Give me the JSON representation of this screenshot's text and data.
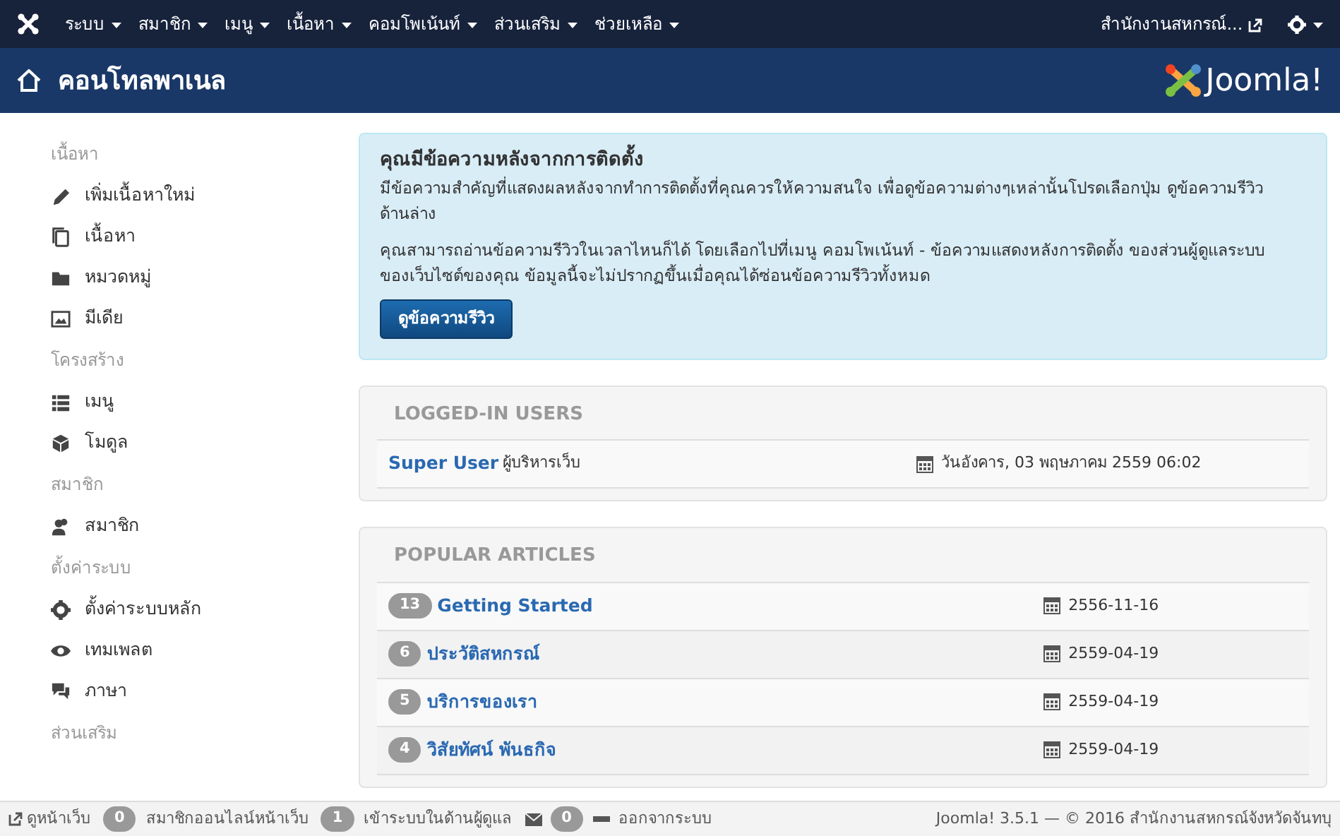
{
  "navbar": {
    "menus": [
      {
        "label": "ระบบ"
      },
      {
        "label": "สมาชิก"
      },
      {
        "label": "เมนู"
      },
      {
        "label": "เนื้อหา"
      },
      {
        "label": "คอมโพเน้นท์"
      },
      {
        "label": "ส่วนเสริม"
      },
      {
        "label": "ช่วยเหลือ"
      }
    ],
    "site_link": "สำนักงานสหกรณ์..."
  },
  "header": {
    "title": "คอนโทลพาเนล",
    "brand": "Joomla!"
  },
  "sidebar": {
    "sections": [
      {
        "heading": "เนื้อหา",
        "items": [
          {
            "label": "เพิ่มเนื้อหาใหม่",
            "kind": "pencil"
          },
          {
            "label": "เนื้อหา",
            "kind": "copy"
          },
          {
            "label": "หมวดหมู่",
            "kind": "folder"
          },
          {
            "label": "มีเดีย",
            "kind": "image"
          }
        ]
      },
      {
        "heading": "โครงสร้าง",
        "items": [
          {
            "label": "เมนู",
            "kind": "list"
          },
          {
            "label": "โมดูล",
            "kind": "cube"
          }
        ]
      },
      {
        "heading": "สมาชิก",
        "items": [
          {
            "label": "สมาชิก",
            "kind": "users"
          }
        ]
      },
      {
        "heading": "ตั้งค่าระบบ",
        "items": [
          {
            "label": "ตั้งค่าระบบหลัก",
            "kind": "gear"
          },
          {
            "label": "เทมเพลต",
            "kind": "eye"
          },
          {
            "label": "ภาษา",
            "kind": "comments"
          }
        ]
      },
      {
        "heading": "ส่วนเสริม"
      }
    ]
  },
  "alert": {
    "title": "คุณมีข้อความหลังจากการติดตั้ง",
    "paragraphs": [
      "มีข้อความสำคัญที่แสดงผลหลังจากทำการติดตั้งที่คุณควรให้ความสนใจ เพื่อดูข้อความต่างๆเหล่านั้นโปรดเลือกปุ่ม ดูข้อความรีวิว ด้านล่าง",
      "คุณสามารถอ่านข้อความรีวิวในเวลาไหนก็ได้ โดยเลือกไปที่เมนู คอมโพเน้นท์ - ข้อความแสดงหลังการติดตั้ง ของส่วนผู้ดูแลระบบของเว็บไซต์ของคุณ ข้อมูลนี้จะไม่ปรากฏขึ้นเมื่อคุณได้ซ่อนข้อความรีวิวทั้งหมด"
    ],
    "button": "ดูข้อความรีวิว"
  },
  "logged_in_users": {
    "title": "LOGGED-IN USERS",
    "rows": [
      {
        "name": "Super User",
        "role": "ผู้บริหารเว็บ",
        "date": "วันอังคาร, 03 พฤษภาคม 2559 06:02"
      }
    ]
  },
  "popular_articles": {
    "title": "POPULAR ARTICLES",
    "rows": [
      {
        "hits": "13",
        "title": "Getting Started",
        "date": "2556-11-16"
      },
      {
        "hits": "6",
        "title": "ประวัติสหกรณ์",
        "date": "2559-04-19"
      },
      {
        "hits": "5",
        "title": "บริการของเรา",
        "date": "2559-04-19"
      },
      {
        "hits": "4",
        "title": "วิสัยทัศน์ พันธกิจ",
        "date": "2559-04-19"
      }
    ]
  },
  "status_bar": {
    "items": [
      {
        "kind": "link",
        "label": "ดูหน้าเว็บ"
      },
      {
        "kind": "count",
        "count": "0",
        "label": "สมาชิกออนไลน์หน้าเว็บ"
      },
      {
        "kind": "count",
        "count": "1",
        "label": "เข้าระบบในด้านผู้ดูแล"
      },
      {
        "kind": "mail",
        "count": "0"
      },
      {
        "kind": "logout",
        "label": "ออกจากระบบ"
      }
    ],
    "copyright": "Joomla! 3.5.1 — © 2016 สำนักงานสหกรณ์จังหวัดจันทบุ"
  }
}
